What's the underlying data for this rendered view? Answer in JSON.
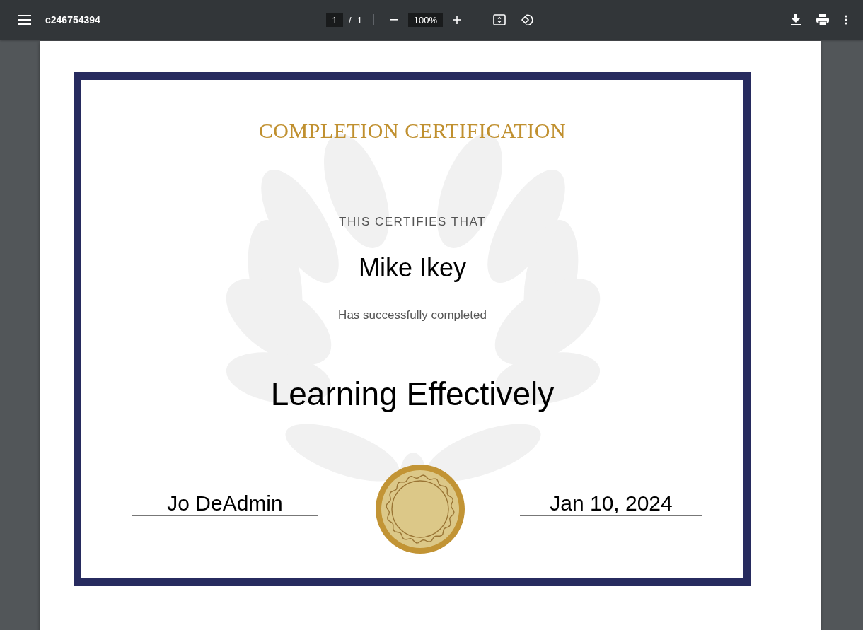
{
  "toolbar": {
    "title": "c246754394",
    "page_current": "1",
    "page_separator": "/",
    "page_total": "1",
    "zoom": "100%"
  },
  "certificate": {
    "heading": "COMPLETION CERTIFICATION",
    "intro": "THIS CERTIFIES THAT",
    "recipient": "Mike Ikey",
    "statement": "Has successfully completed",
    "course": "Learning Effectively",
    "signature": "Jo DeAdmin",
    "date": "Jan 10, 2024"
  }
}
